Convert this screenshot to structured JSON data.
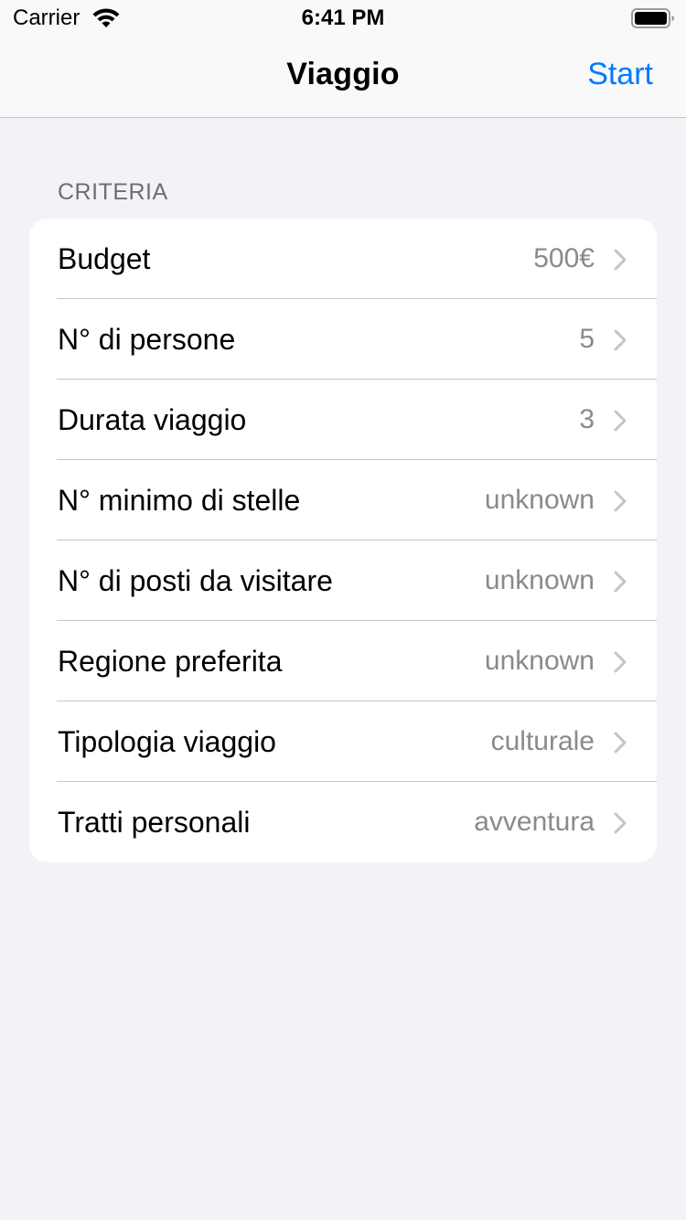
{
  "status_bar": {
    "carrier": "Carrier",
    "time": "6:41 PM",
    "wifi_icon": "wifi-icon",
    "battery_icon": "battery-icon"
  },
  "nav": {
    "title": "Viaggio",
    "action_label": "Start",
    "accent_color": "#007aff"
  },
  "section": {
    "header": "CRITERIA",
    "rows": [
      {
        "label": "Budget",
        "value": "500€"
      },
      {
        "label": "N° di persone",
        "value": "5"
      },
      {
        "label": "Durata viaggio",
        "value": "3"
      },
      {
        "label": "N° minimo di stelle",
        "value": "unknown"
      },
      {
        "label": "N° di posti da visitare",
        "value": "unknown"
      },
      {
        "label": "Regione preferita",
        "value": "unknown"
      },
      {
        "label": "Tipologia viaggio",
        "value": "culturale"
      },
      {
        "label": "Tratti personali",
        "value": "avventura"
      }
    ],
    "chevron_icon": "chevron-right-icon"
  }
}
